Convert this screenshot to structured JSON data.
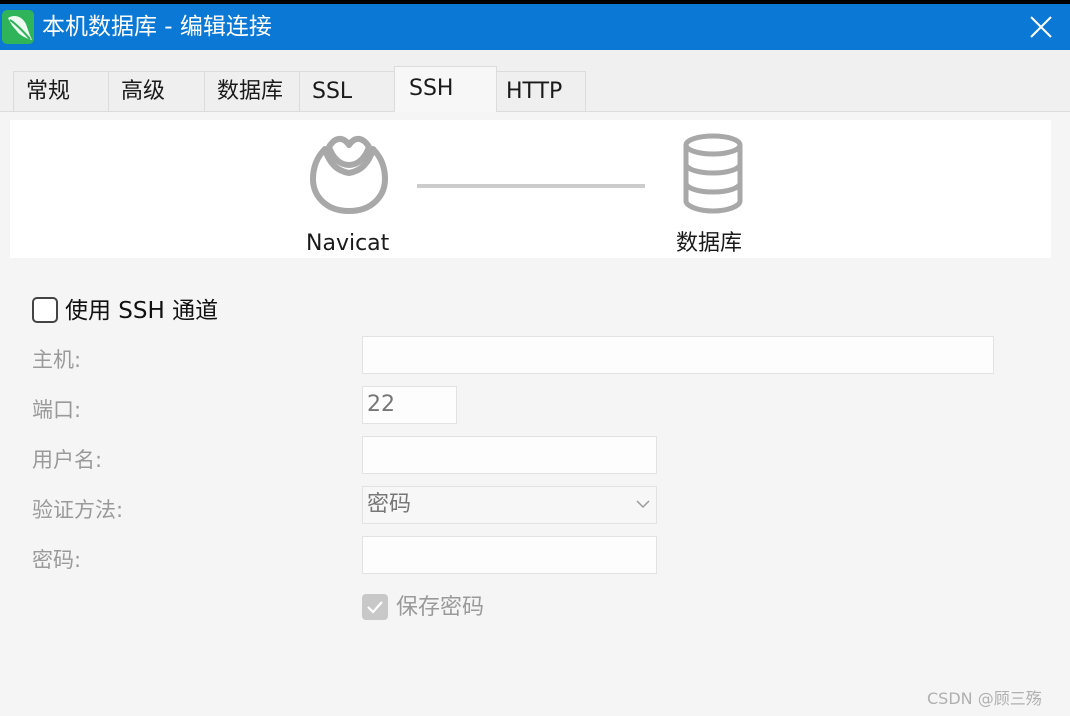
{
  "window": {
    "title": "本机数据库 - 编辑连接",
    "app_icon": "navicat-leaf-icon",
    "close_icon": "close-icon",
    "title_bar_color": "#0a78d4"
  },
  "tabs": [
    {
      "label": "常规",
      "active": false
    },
    {
      "label": "高级",
      "active": false
    },
    {
      "label": "数据库",
      "active": false
    },
    {
      "label": "SSL",
      "active": false
    },
    {
      "label": "SSH",
      "active": true
    },
    {
      "label": "HTTP",
      "active": false
    }
  ],
  "diagram": {
    "left_label": "Navicat",
    "right_label": "数据库",
    "left_icon": "navicat-icon",
    "right_icon": "database-icon"
  },
  "form": {
    "use_ssh": {
      "label": "使用 SSH 通道",
      "checked": false
    },
    "host": {
      "label": "主机:",
      "value": ""
    },
    "port": {
      "label": "端口:",
      "value": "22"
    },
    "username": {
      "label": "用户名:",
      "value": ""
    },
    "auth_method": {
      "label": "验证方法:",
      "value": "密码"
    },
    "password": {
      "label": "密码:",
      "value": ""
    },
    "save_password": {
      "label": "保存密码",
      "checked": true,
      "disabled": true
    }
  },
  "watermark": "CSDN @顾三殇"
}
